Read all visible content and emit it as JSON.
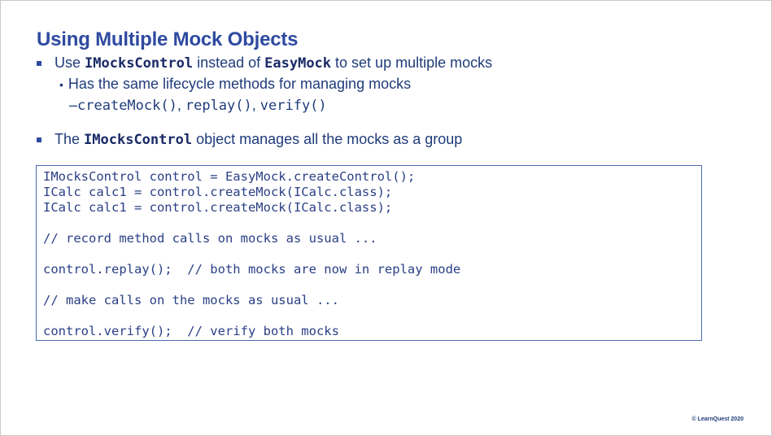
{
  "slide": {
    "title": "Using Multiple Mock Objects",
    "bullet1": {
      "prefix": "Use ",
      "code1": "IMocksControl",
      "middle": " instead of ",
      "code2": "EasyMock",
      "suffix": " to set up multiple mocks"
    },
    "sub_bullet": {
      "marker": "•",
      "text": "Has the same lifecycle methods for managing mocks"
    },
    "sub_sub": {
      "marker": "–",
      "m1": "createMock()",
      "sep1": ", ",
      "m2": "replay()",
      "sep2": ", ",
      "m3": "verify()"
    },
    "bullet2": {
      "prefix": "The ",
      "code": "IMocksControl",
      "suffix": " object manages all the mocks as a group"
    },
    "code_lines": [
      "IMocksControl control = EasyMock.createControl();",
      "ICalc calc1 = control.createMock(ICalc.class);",
      "ICalc calc1 = control.createMock(ICalc.class);",
      "// record method calls on mocks as usual ...",
      "control.replay();  // both mocks are now in replay mode",
      "// make calls on the mocks as usual ...",
      "control.verify();  // verify both mocks"
    ],
    "copyright": "© LearnQuest 2020"
  }
}
